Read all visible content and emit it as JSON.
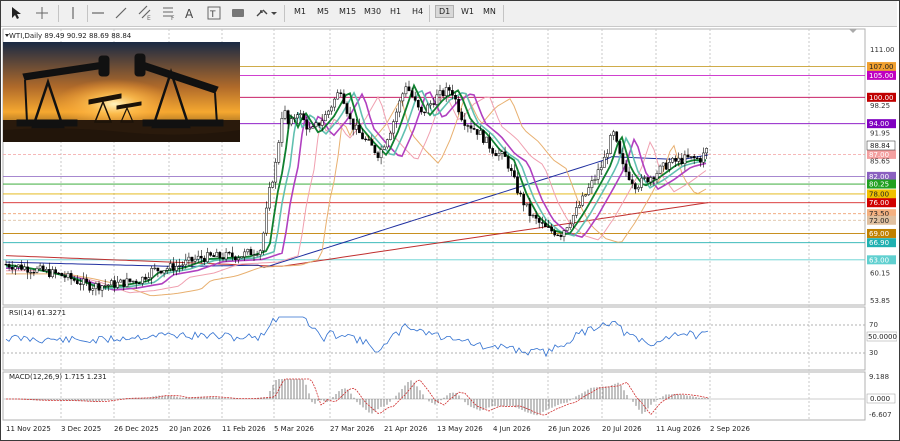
{
  "toolbar": {
    "timeframes": [
      "M1",
      "M5",
      "M15",
      "M30",
      "H1",
      "H4",
      "D1",
      "W1",
      "MN"
    ],
    "active_timeframe": "D1",
    "icons": [
      "cursor-icon",
      "crosshair-icon",
      "vertical-line-icon",
      "horizontal-line-icon",
      "trendline-icon",
      "equidistant-channel-icon",
      "fibonacci-icon",
      "text-icon",
      "text-label-icon",
      "rectangle-icon",
      "arrows-icon"
    ]
  },
  "chart": {
    "symbol_header": "WTI,Daily  89.49 90.92 88.69 88.84",
    "price_labels": [
      "111.00",
      "98.25",
      "91.95",
      "85.65",
      "60.15",
      "53.85"
    ],
    "current_price": "88.84",
    "levels": [
      {
        "label": "107.00",
        "price": 107.0,
        "color": "#f0a030",
        "line": "#c8a030",
        "text_dark": true
      },
      {
        "label": "105.00",
        "price": 105.0,
        "color": "#c000c0",
        "line": "#c000c0",
        "text_dark": false
      },
      {
        "label": "100.00",
        "price": 100.0,
        "color": "#c00000",
        "line": "#c00050",
        "text_dark": false
      },
      {
        "label": "94.00",
        "price": 94.0,
        "color": "#8000c0",
        "line": "#8000c0",
        "text_dark": false
      },
      {
        "label": "87.00",
        "price": 87.0,
        "color": "#f4a0a0",
        "line": "#f4a0a0",
        "text_dark": false
      },
      {
        "label": "82.00",
        "price": 82.0,
        "color": "#8a60c0",
        "line": "#8a60c0",
        "text_dark": false
      },
      {
        "label": "80.25",
        "price": 80.25,
        "color": "#20a020",
        "line": "#20a020",
        "text_dark": false
      },
      {
        "label": "78.00",
        "price": 78.0,
        "color": "#f0c000",
        "line": "#e0b000",
        "text_dark": true
      },
      {
        "label": "76.00",
        "price": 76.0,
        "color": "#d00000",
        "line": "#d00000",
        "text_dark": false
      },
      {
        "label": "73.50",
        "price": 73.5,
        "color": "#f4b080",
        "line": "#f0a070",
        "text_dark": true
      },
      {
        "label": "72.00",
        "price": 72.0,
        "color": "#e0c0a0",
        "line": "#d8b898",
        "text_dark": true
      },
      {
        "label": "69.00",
        "price": 69.0,
        "color": "#c08000",
        "line": "#c08000",
        "text_dark": false
      },
      {
        "label": "66.90",
        "price": 66.9,
        "color": "#20b0b0",
        "line": "#20b0b0",
        "text_dark": false
      },
      {
        "label": "63.00",
        "price": 63.0,
        "color": "#60d0d0",
        "line": "#60d0d0",
        "text_dark": false
      }
    ],
    "time_labels": [
      "11 Nov 2025",
      "3 Dec 2025",
      "26 Dec 2025",
      "20 Jan 2026",
      "11 Feb 2026",
      "5 Mar 2026",
      "27 Mar 2026",
      "21 Apr 2026",
      "13 May 2026",
      "4 Jun 2026",
      "26 Jun 2026",
      "20 Jul 2026",
      "11 Aug 2026",
      "2 Sep 2026"
    ]
  },
  "rsi": {
    "header": "RSI(14) 61.3271",
    "levels": [
      "70",
      "30"
    ],
    "current": "50.0000"
  },
  "macd": {
    "header": "MACD(12,26,9) 1.715 1.231",
    "labels": [
      "9.188",
      "0.000",
      "-6.607"
    ]
  }
}
